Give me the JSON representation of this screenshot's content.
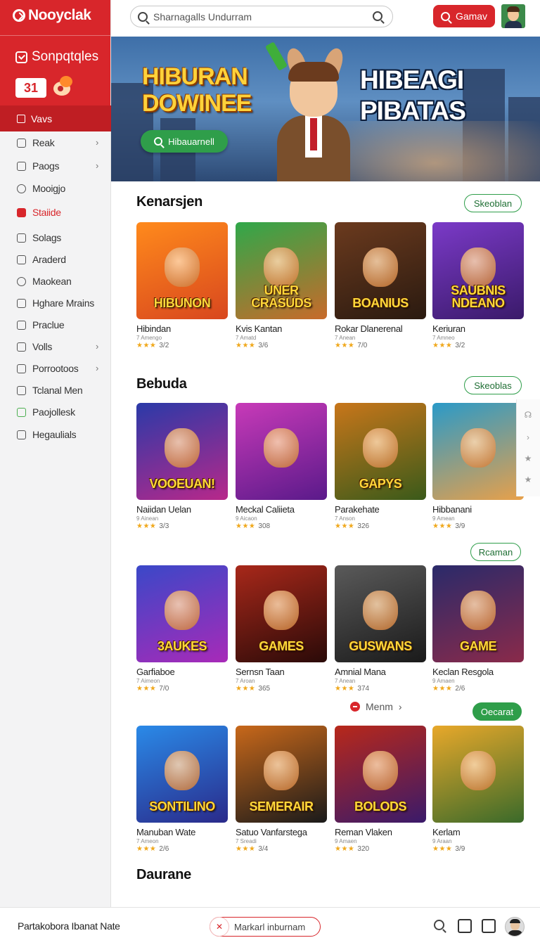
{
  "brand": {
    "name": "Nooyclak",
    "accent": "#d8262b",
    "green": "#2f9e4a"
  },
  "sidebar": {
    "section_title": "Sonpqtqles",
    "badge_number": "31",
    "active_item": "Vavs",
    "items": [
      {
        "label": "Reak",
        "icon": "square-icon",
        "chevron": true
      },
      {
        "label": "Paogs",
        "icon": "tag-icon",
        "chevron": true
      },
      {
        "label": "Mooigjo",
        "icon": "search-icon",
        "chevron": false
      },
      {
        "label": "Staiide",
        "icon": "flag-icon",
        "chevron": false,
        "highlight": true
      },
      {
        "label": "Solags",
        "icon": "square-icon",
        "chevron": false
      },
      {
        "label": "Araderd",
        "icon": "doc-icon",
        "chevron": false
      },
      {
        "label": "Maokean",
        "icon": "search-icon",
        "chevron": false
      },
      {
        "label": "Hghare Mrains",
        "icon": "square-icon",
        "chevron": false
      },
      {
        "label": "Praclue",
        "icon": "square-icon",
        "chevron": false
      },
      {
        "label": "Volls",
        "icon": "doc-icon",
        "chevron": true
      },
      {
        "label": "Porrootoos",
        "icon": "square-icon",
        "chevron": true
      },
      {
        "label": "Tclanal Men",
        "icon": "pin-icon",
        "chevron": false
      },
      {
        "label": "Paojollesk",
        "icon": "doc-icon",
        "chevron": false
      },
      {
        "label": "Hegaulials",
        "icon": "square-icon",
        "chevron": false
      }
    ]
  },
  "topbar": {
    "search_placeholder": "Sharnagalls Undurram",
    "game_button": "Gamav"
  },
  "banner": {
    "title_left": "HIBURAN DOWINEE",
    "title_right": "HIBEAGI PIBATAS",
    "button_label": "Hibauarnell"
  },
  "sections": [
    {
      "title": "Kenarsjen",
      "pill": "Skeoblan",
      "pill_filled": false,
      "cards": [
        {
          "name": "Hibindan",
          "sub": "7 Amengo",
          "rating": "3/2",
          "art_text": "HIBUNON",
          "bg": [
            "#ff8a1c",
            "#d8471e"
          ]
        },
        {
          "name": "Kvis Kantan",
          "sub": "7 Amatd",
          "rating": "3/6",
          "art_text": "UNER CRASUDS",
          "bg": [
            "#2fa84a",
            "#c86a2a"
          ]
        },
        {
          "name": "Rokar Dlanerenal",
          "sub": "7 Anean",
          "rating": "7/0",
          "art_text": "BOANIUS",
          "bg": [
            "#6b3a1e",
            "#2a1a10"
          ]
        },
        {
          "name": "Keriuran",
          "sub": "7 Amneo",
          "rating": "3/2",
          "art_text": "SAUBNIS NDEANO",
          "bg": [
            "#7b3ac8",
            "#3a1a6a"
          ]
        }
      ]
    },
    {
      "title": "Bebuda",
      "pill": "Skeoblas",
      "pill_filled": false,
      "cards": [
        {
          "name": "Naiidan Uelan",
          "sub": "9 Ainean",
          "rating": "3/3",
          "art_text": "VOOEUAN!",
          "bg": [
            "#2a3aa8",
            "#b8288a"
          ]
        },
        {
          "name": "Meckal Caliieta",
          "sub": "9 Aicaon",
          "rating": "308",
          "art_text": "",
          "bg": [
            "#c83ab8",
            "#5a1a8a"
          ]
        },
        {
          "name": "Parakehate",
          "sub": "7 Anson",
          "rating": "326",
          "art_text": "GAPYS",
          "bg": [
            "#c8761a",
            "#3a5a1a"
          ]
        },
        {
          "name": "Hibbanani",
          "sub": "9 Amean",
          "rating": "3/9",
          "art_text": "",
          "bg": [
            "#2a9ac8",
            "#e8a04a"
          ]
        }
      ]
    },
    {
      "title": "",
      "pill": "Rcaman",
      "pill_filled": false,
      "cards": [
        {
          "name": "Garfiaboe",
          "sub": "7 Aimeon",
          "rating": "7/0",
          "art_text": "3AUKES",
          "bg": [
            "#3a48c8",
            "#a82ab8"
          ]
        },
        {
          "name": "Sernsn Taan",
          "sub": "7 Aroan",
          "rating": "365",
          "art_text": "GAMES",
          "bg": [
            "#a8281a",
            "#2a0a08"
          ]
        },
        {
          "name": "Amnial Mana",
          "sub": "7 Anean",
          "rating": "374",
          "art_text": "GUSWANS",
          "bg": [
            "#5a5a5a",
            "#1a1a1a"
          ]
        },
        {
          "name": "Keclan Resgola",
          "sub": "9 Amaen",
          "rating": "2/6",
          "art_text": "GAME",
          "bg": [
            "#2a2a6a",
            "#8a2a4a"
          ]
        }
      ]
    },
    {
      "title": "",
      "pill": "Oecarat",
      "pill_filled": true,
      "cards": [
        {
          "name": "Manuban Wate",
          "sub": "7 Ameon",
          "rating": "2/6",
          "art_text": "SONTILINO",
          "bg": [
            "#2a8ae8",
            "#2a2a8a"
          ]
        },
        {
          "name": "Satuo Vanfarstega",
          "sub": "7 Sreadi",
          "rating": "3/4",
          "art_text": "SEMERAIR",
          "bg": [
            "#c8681a",
            "#1a1a1a"
          ]
        },
        {
          "name": "Reman Vlaken",
          "sub": "9 Amaen",
          "rating": "320",
          "art_text": "BOLODS",
          "bg": [
            "#b8281a",
            "#3a1a6a"
          ]
        },
        {
          "name": "Kerlam",
          "sub": "9 Araan",
          "rating": "3/9",
          "art_text": "",
          "bg": [
            "#e8a82a",
            "#3a6a2a"
          ]
        }
      ]
    }
  ],
  "footer_section": {
    "title": "Daurane",
    "more_label": "Menm"
  },
  "bottombar": {
    "left_text": "Partakobora Ibanat Nate",
    "search_placeholder": "Markarl inburnam"
  }
}
